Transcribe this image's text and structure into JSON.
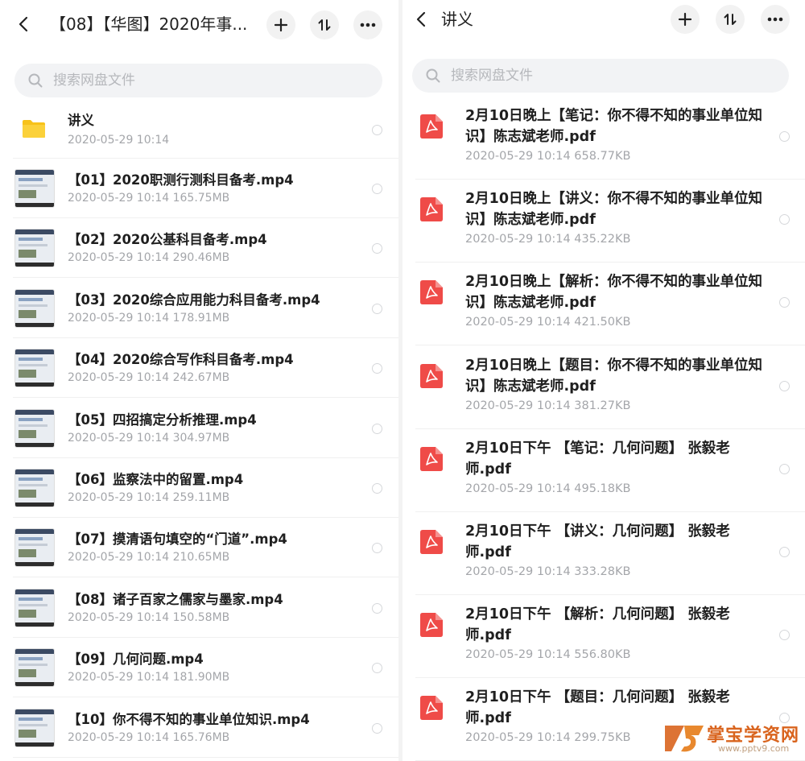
{
  "left": {
    "title": "【08】【华图】2020年事...",
    "search_placeholder": "搜索网盘文件",
    "folder": {
      "name": "讲义",
      "meta": "2020-05-29  10:14"
    },
    "files": [
      {
        "name": "【01】2020职测行测科目备考.mp4",
        "meta": "2020-05-29  10:14   165.75MB"
      },
      {
        "name": "【02】2020公基科目备考.mp4",
        "meta": "2020-05-29  10:14   290.46MB"
      },
      {
        "name": "【03】2020综合应用能力科目备考.mp4",
        "meta": "2020-05-29  10:14   178.91MB"
      },
      {
        "name": "【04】2020综合写作科目备考.mp4",
        "meta": "2020-05-29  10:14   242.67MB"
      },
      {
        "name": "【05】四招搞定分析推理.mp4",
        "meta": "2020-05-29  10:14   304.97MB"
      },
      {
        "name": "【06】监察法中的留置.mp4",
        "meta": "2020-05-29  10:14   259.11MB"
      },
      {
        "name": "【07】摸清语句填空的“门道”.mp4",
        "meta": "2020-05-29  10:14   210.65MB"
      },
      {
        "name": "【08】诸子百家之儒家与墨家.mp4",
        "meta": "2020-05-29  10:14   150.58MB"
      },
      {
        "name": "【09】几何问题.mp4",
        "meta": "2020-05-29  10:14   181.90MB"
      },
      {
        "name": "【10】你不得不知的事业单位知识.mp4",
        "meta": "2020-05-29  10:14   165.76MB"
      }
    ]
  },
  "right": {
    "title": "讲义",
    "search_placeholder": "搜索网盘文件",
    "files": [
      {
        "name": "2月10日晚上【笔记：你不得不知的事业单位知识】陈志斌老师.pdf",
        "meta": "2020-05-29  10:14   658.77KB"
      },
      {
        "name": "2月10日晚上【讲义：你不得不知的事业单位知识】陈志斌老师.pdf",
        "meta": "2020-05-29  10:14   435.22KB"
      },
      {
        "name": "2月10日晚上【解析：你不得不知的事业单位知识】陈志斌老师.pdf",
        "meta": "2020-05-29  10:14   421.50KB"
      },
      {
        "name": "2月10日晚上【题目：你不得不知的事业单位知识】陈志斌老师.pdf",
        "meta": "2020-05-29  10:14   381.27KB"
      },
      {
        "name": "2月10日下午 【笔记：几何问题】 张毅老师.pdf",
        "meta": "2020-05-29  10:14   495.18KB"
      },
      {
        "name": "2月10日下午 【讲义：几何问题】 张毅老师.pdf",
        "meta": "2020-05-29  10:14   333.28KB"
      },
      {
        "name": "2月10日下午 【解析：几何问题】 张毅老师.pdf",
        "meta": "2020-05-29  10:14   556.80KB"
      },
      {
        "name": "2月10日下午 【题目：几何问题】 张毅老师.pdf",
        "meta": "2020-05-29  10:14   299.75KB"
      }
    ]
  },
  "icons": {
    "back": "back-arrow-icon",
    "add": "plus-icon",
    "sort": "sort-icon",
    "more": "more-icon",
    "search": "search-icon",
    "folder": "folder-icon",
    "pdf": "pdf-icon",
    "video": "video-thumbnail"
  },
  "colors": {
    "folder": "#f7c21a",
    "pdf": "#ef4b48",
    "watermark": "#d9641e"
  },
  "watermark": {
    "brand": "掌宝学资网",
    "url": "www.pptv9.com"
  }
}
